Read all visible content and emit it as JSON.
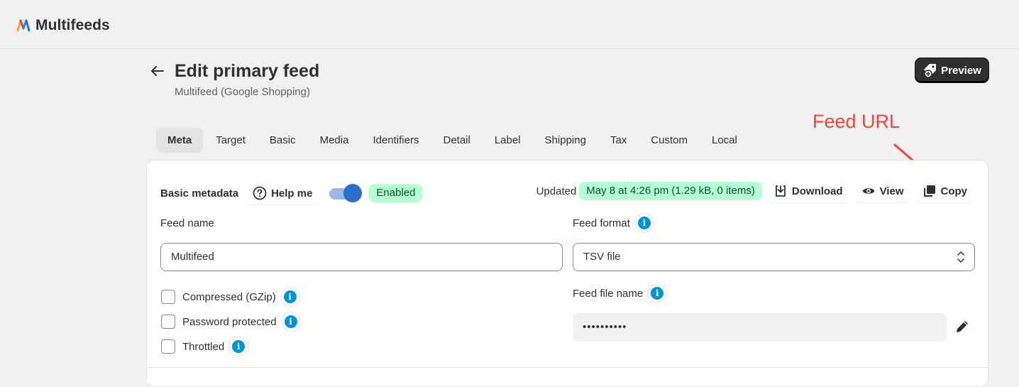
{
  "app": {
    "name": "Multifeeds"
  },
  "page": {
    "title": "Edit primary feed",
    "subtitle": "Multifeed (Google Shopping)",
    "preview_label": "Preview"
  },
  "annotation": {
    "text": "Feed URL",
    "color": "#f04438"
  },
  "tabs": [
    {
      "label": "Meta",
      "active": true
    },
    {
      "label": "Target"
    },
    {
      "label": "Basic"
    },
    {
      "label": "Media"
    },
    {
      "label": "Identifiers"
    },
    {
      "label": "Detail"
    },
    {
      "label": "Label"
    },
    {
      "label": "Shipping"
    },
    {
      "label": "Tax"
    },
    {
      "label": "Custom"
    },
    {
      "label": "Local"
    }
  ],
  "meta": {
    "section_title": "Basic metadata",
    "help_label": "Help me",
    "enabled": true,
    "enabled_label": "Enabled",
    "updated_label": "Updated",
    "updated_value": "May 8 at 4:26 pm (1.29 kB, 0 items)",
    "download_label": "Download",
    "view_label": "View",
    "copy_label": "Copy",
    "feed_name_label": "Feed name",
    "feed_name_value": "Multifeed",
    "feed_format_label": "Feed format",
    "feed_format_value": "TSV file",
    "checkboxes": [
      {
        "label": "Compressed (GZip)",
        "checked": false
      },
      {
        "label": "Password protected",
        "checked": false
      },
      {
        "label": "Throttled",
        "checked": false
      }
    ],
    "feed_file_name_label": "Feed file name",
    "feed_file_name_value": "••••••••••"
  },
  "colors": {
    "accent": "#2c6ecb",
    "success_bg": "#b4fed2",
    "info": "#0094d5",
    "primary_button": "#303030"
  }
}
